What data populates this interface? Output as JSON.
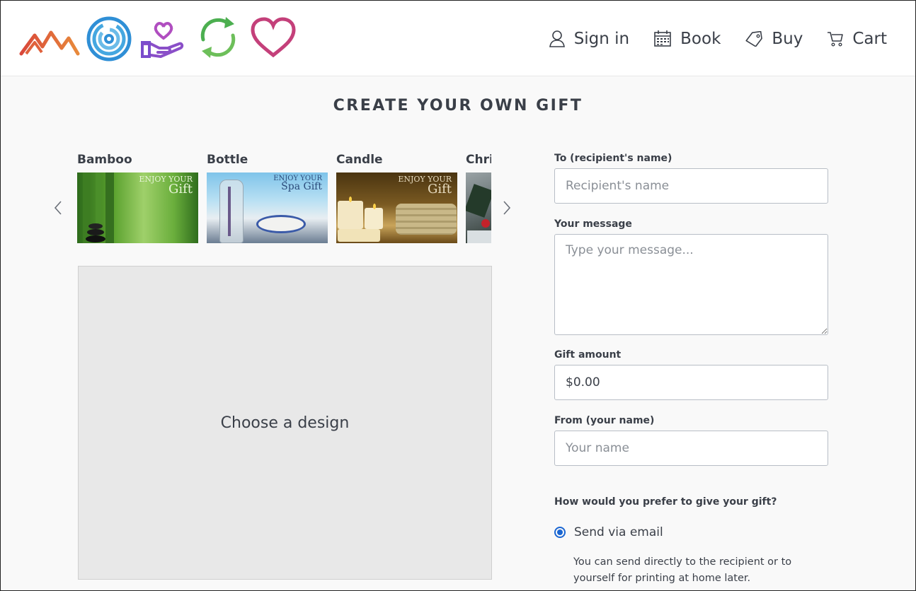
{
  "header": {
    "logo_icons": [
      "mountains-logo-icon",
      "swirl-logo-icon",
      "heart-hand-logo-icon",
      "recycle-arrows-logo-icon",
      "heart-logo-icon"
    ],
    "nav": [
      {
        "label": "Sign in",
        "icon": "user-icon"
      },
      {
        "label": "Book",
        "icon": "calendar-icon"
      },
      {
        "label": "Buy",
        "icon": "tag-icon"
      },
      {
        "label": "Cart",
        "icon": "cart-icon"
      }
    ]
  },
  "page": {
    "title": "CREATE YOUR OWN GIFT"
  },
  "designs": {
    "items": [
      {
        "name": "Bamboo",
        "caption_top": "ENJOY YOUR",
        "caption_main": "Gift"
      },
      {
        "name": "Bottle",
        "caption_top": "ENJOY YOUR",
        "caption_main": "Spa Gift"
      },
      {
        "name": "Candle",
        "caption_top": "ENJOY YOUR",
        "caption_main": "Gift"
      },
      {
        "name": "Christmas",
        "caption_top": "",
        "caption_main": ""
      }
    ],
    "prev_icon": "chevron-left-icon",
    "next_icon": "chevron-right-icon",
    "preview_text": "Choose a design"
  },
  "form": {
    "to_label": "To (recipient's name)",
    "to_placeholder": "Recipient's name",
    "message_label": "Your message",
    "message_placeholder": "Type your message...",
    "amount_label": "Gift amount",
    "amount_value": "$0.00",
    "from_label": "From (your name)",
    "from_placeholder": "Your name",
    "delivery_question": "How would you prefer to give your gift?",
    "delivery_option": "Send via email",
    "delivery_help": "You can send directly to the recipient or to yourself for printing at home later."
  },
  "colors": {
    "accent": "#1a66d2",
    "text": "#3a3f48"
  }
}
